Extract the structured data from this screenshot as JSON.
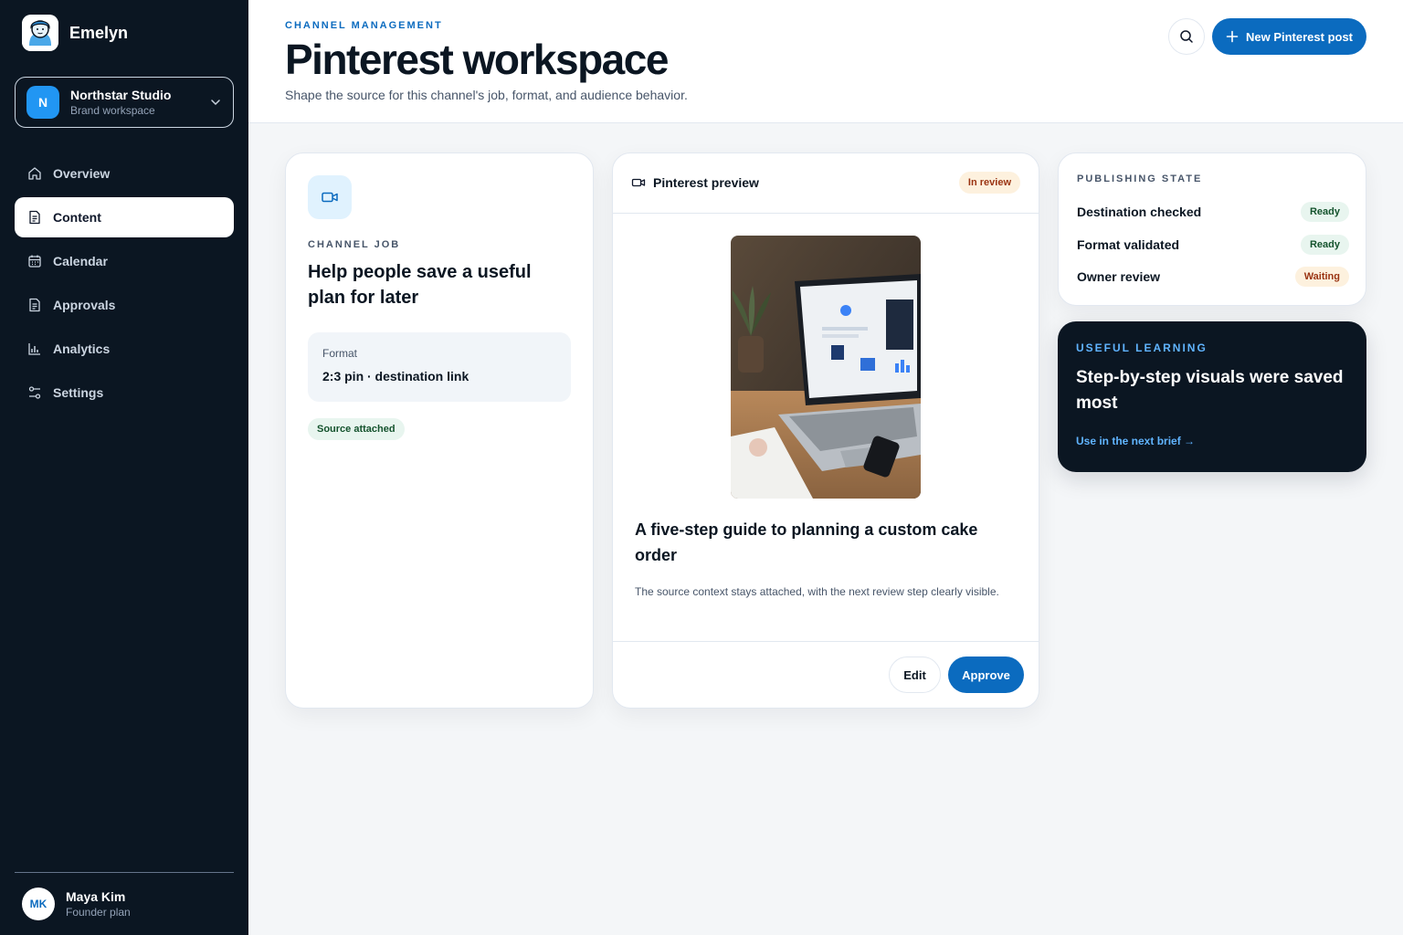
{
  "sidebar": {
    "brand": {
      "name": "Emelyn"
    },
    "workspace": {
      "initial": "N",
      "name": "Northstar Studio",
      "subtitle": "Brand workspace"
    },
    "nav": [
      {
        "label": "Overview",
        "icon": "home-icon",
        "active": false
      },
      {
        "label": "Content",
        "icon": "document-icon",
        "active": true
      },
      {
        "label": "Calendar",
        "icon": "calendar-icon",
        "active": false
      },
      {
        "label": "Approvals",
        "icon": "clipboard-icon",
        "active": false
      },
      {
        "label": "Analytics",
        "icon": "bar-chart-icon",
        "active": false
      },
      {
        "label": "Settings",
        "icon": "sliders-icon",
        "active": false
      }
    ],
    "user": {
      "initials": "MK",
      "name": "Maya Kim",
      "plan": "Founder plan"
    }
  },
  "header": {
    "eyebrow": "CHANNEL MANAGEMENT",
    "title": "Pinterest workspace",
    "subtitle": "Shape the source for this channel's job, format, and audience behavior.",
    "primary_button": "New Pinterest post"
  },
  "job_card": {
    "label": "CHANNEL JOB",
    "title": "Help people save a useful plan for later",
    "format_label": "Format",
    "format_value": "2:3 pin · destination link",
    "badge": "Source attached"
  },
  "preview_card": {
    "title": "Pinterest preview",
    "status": "In review",
    "pin_title": "A five-step guide to planning a custom cake order",
    "pin_description": "The source context stays attached, with the next review step clearly visible.",
    "edit_label": "Edit",
    "approve_label": "Approve"
  },
  "publishing_state": {
    "label": "PUBLISHING STATE",
    "rows": [
      {
        "name": "Destination checked",
        "status": "Ready"
      },
      {
        "name": "Format validated",
        "status": "Ready"
      },
      {
        "name": "Owner review",
        "status": "Waiting"
      }
    ]
  },
  "learning": {
    "label": "USEFUL LEARNING",
    "title": "Step-by-step visuals were saved most",
    "link": "Use in the next brief →"
  },
  "colors": {
    "accent": "#0b6bbf",
    "sidebar_bg": "#0b1622",
    "ready_bg": "#e8f5ef",
    "waiting_bg": "#fdf1de"
  }
}
